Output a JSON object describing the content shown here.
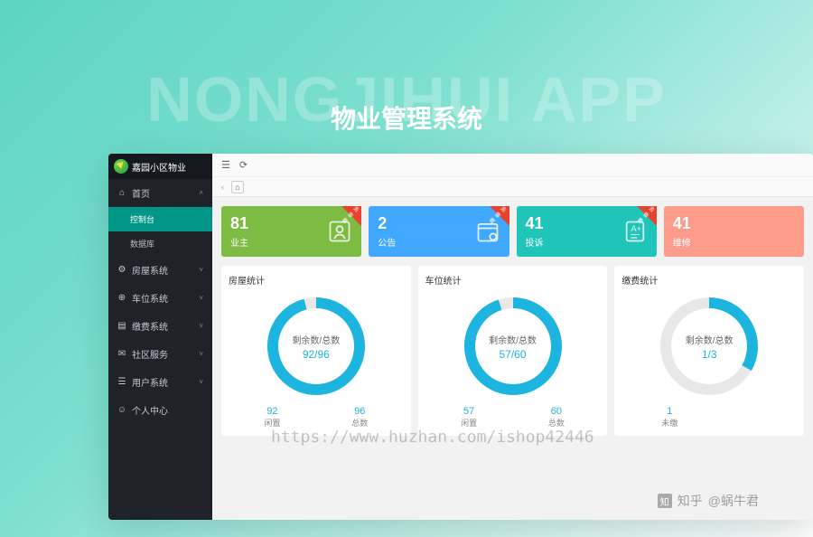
{
  "bg_text": "NONGJIHUI APP",
  "title": "物业管理系统",
  "sidebar": {
    "brand": "嘉园小区物业",
    "items": [
      {
        "icon": "home",
        "label": "首页",
        "expanded": true,
        "children": [
          {
            "label": "控制台",
            "active": true
          },
          {
            "label": "数据库",
            "active": false
          }
        ]
      },
      {
        "icon": "gear",
        "label": "房屋系统"
      },
      {
        "icon": "car",
        "label": "车位系统"
      },
      {
        "icon": "money",
        "label": "缴费系统"
      },
      {
        "icon": "community",
        "label": "社区服务"
      },
      {
        "icon": "user",
        "label": "用户系统"
      },
      {
        "icon": "person",
        "label": "个人中心"
      }
    ]
  },
  "stat_cards": [
    {
      "value": "81",
      "label": "业主",
      "color": "green",
      "icon": "owner"
    },
    {
      "value": "2",
      "label": "公告",
      "color": "blue",
      "icon": "calendar"
    },
    {
      "value": "41",
      "label": "投诉",
      "color": "teal",
      "icon": "note"
    },
    {
      "value": "41",
      "label": "维修",
      "color": "peach",
      "icon": "wrench"
    }
  ],
  "ribbon_text": "去查看",
  "panels": [
    {
      "title": "房屋统计",
      "center_label": "剩余数/总数",
      "ratio": "92/96",
      "pct": 95.8,
      "footer": [
        {
          "val": "92",
          "lbl": "闲置"
        },
        {
          "val": "96",
          "lbl": "总数"
        }
      ]
    },
    {
      "title": "车位统计",
      "center_label": "剩余数/总数",
      "ratio": "57/60",
      "pct": 95.0,
      "footer": [
        {
          "val": "57",
          "lbl": "闲置"
        },
        {
          "val": "60",
          "lbl": "总数"
        }
      ]
    },
    {
      "title": "缴费统计",
      "center_label": "剩余数/总数",
      "ratio": "1/3",
      "pct": 33.3,
      "footer": [
        {
          "val": "1",
          "lbl": "未缴"
        },
        {
          "val": "",
          "lbl": ""
        }
      ]
    }
  ],
  "watermark": "https://www.huzhan.com/ishop42446",
  "credit_prefix": "知乎",
  "credit_user": "@蜗牛君"
}
